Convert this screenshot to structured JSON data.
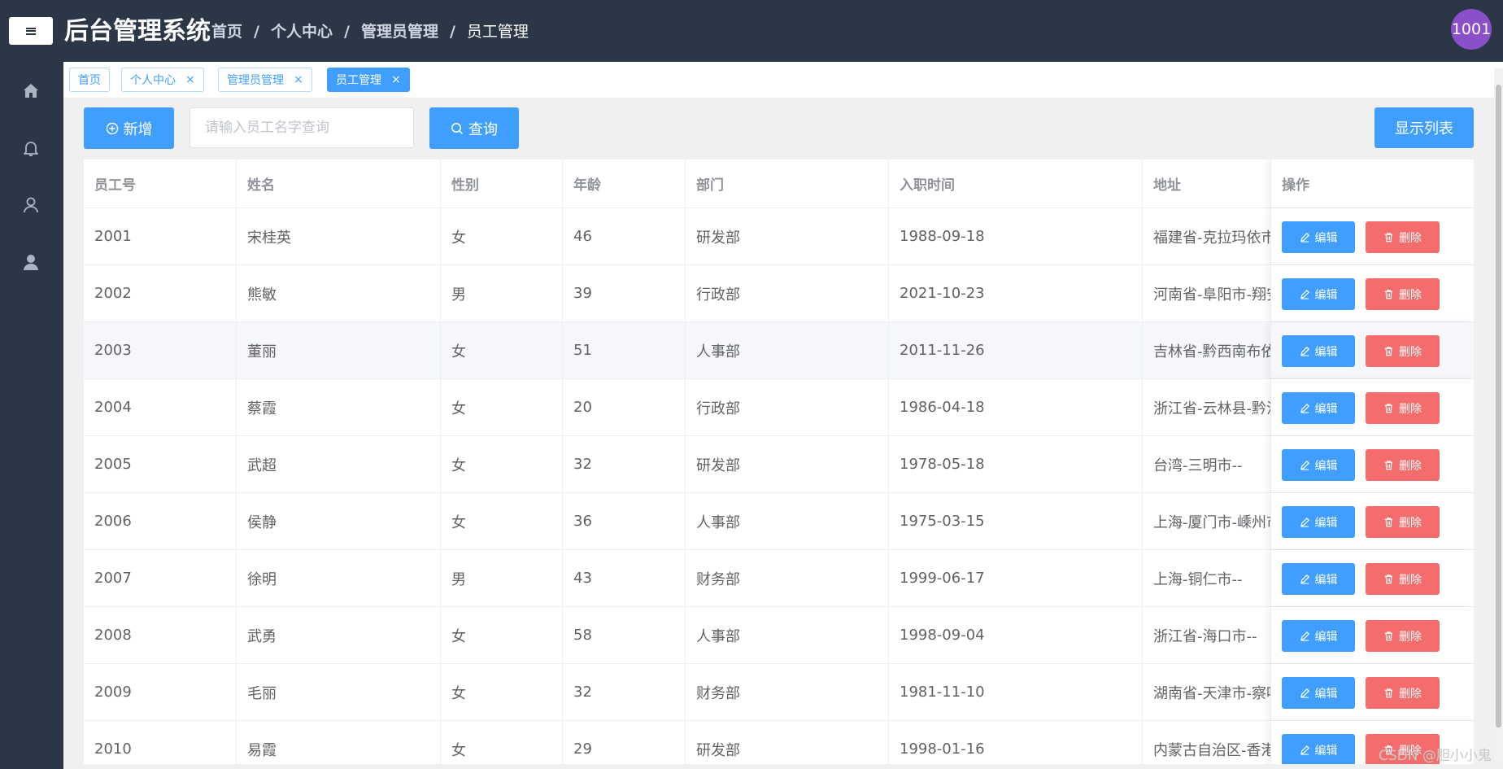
{
  "header": {
    "menu_toggle": "≡",
    "title": "后台管理系统",
    "breadcrumb": [
      "首页",
      "个人中心",
      "管理员管理",
      "员工管理"
    ],
    "separator": "/",
    "avatar_text": "1001"
  },
  "sidebar": {
    "items": [
      {
        "icon": "home-icon"
      },
      {
        "icon": "bell-icon"
      },
      {
        "icon": "user-outline-icon"
      },
      {
        "icon": "user-solid-icon"
      }
    ]
  },
  "tabs": [
    {
      "label": "首页",
      "closable": false,
      "active": false
    },
    {
      "label": "个人中心",
      "closable": true,
      "active": false
    },
    {
      "label": "管理员管理",
      "closable": true,
      "active": false
    },
    {
      "label": "员工管理",
      "closable": true,
      "active": true
    }
  ],
  "tab_close": "×",
  "toolbar": {
    "add_label": "新增",
    "search_placeholder": "请输入员工名字查询",
    "query_label": "查询",
    "list_label": "显示列表"
  },
  "table": {
    "columns": [
      "员工号",
      "姓名",
      "性别",
      "年龄",
      "部门",
      "入职时间",
      "地址",
      "操作"
    ],
    "edit_label": "编辑",
    "delete_label": "删除",
    "rows": [
      {
        "id": "2001",
        "name": "宋桂英",
        "gender": "女",
        "age": "46",
        "dept": "研发部",
        "date": "1988-09-18",
        "address": "福建省-克拉玛依市"
      },
      {
        "id": "2002",
        "name": "熊敏",
        "gender": "男",
        "age": "39",
        "dept": "行政部",
        "date": "2021-10-23",
        "address": "河南省-阜阳市-翔安"
      },
      {
        "id": "2003",
        "name": "董丽",
        "gender": "女",
        "age": "51",
        "dept": "人事部",
        "date": "2011-11-26",
        "address": "吉林省-黔西南布依"
      },
      {
        "id": "2004",
        "name": "蔡霞",
        "gender": "女",
        "age": "20",
        "dept": "行政部",
        "date": "1986-04-18",
        "address": "浙江省-云林县-黔江"
      },
      {
        "id": "2005",
        "name": "武超",
        "gender": "女",
        "age": "32",
        "dept": "研发部",
        "date": "1978-05-18",
        "address": "台湾-三明市--"
      },
      {
        "id": "2006",
        "name": "侯静",
        "gender": "女",
        "age": "36",
        "dept": "人事部",
        "date": "1975-03-15",
        "address": "上海-厦门市-嵊州市"
      },
      {
        "id": "2007",
        "name": "徐明",
        "gender": "男",
        "age": "43",
        "dept": "财务部",
        "date": "1999-06-17",
        "address": "上海-铜仁市--"
      },
      {
        "id": "2008",
        "name": "武勇",
        "gender": "女",
        "age": "58",
        "dept": "人事部",
        "date": "1998-09-04",
        "address": "浙江省-海口市--"
      },
      {
        "id": "2009",
        "name": "毛丽",
        "gender": "女",
        "age": "32",
        "dept": "财务部",
        "date": "1981-11-10",
        "address": "湖南省-天津市-察哈"
      },
      {
        "id": "2010",
        "name": "易霞",
        "gender": "女",
        "age": "29",
        "dept": "研发部",
        "date": "1998-01-16",
        "address": "内蒙古自治区-香港"
      }
    ]
  },
  "watermark": "CSDN @胆小小鬼",
  "colors": {
    "header_bg": "#2b3647",
    "primary": "#409eff",
    "danger": "#f56c6c",
    "avatar": "#8a4fc9"
  }
}
